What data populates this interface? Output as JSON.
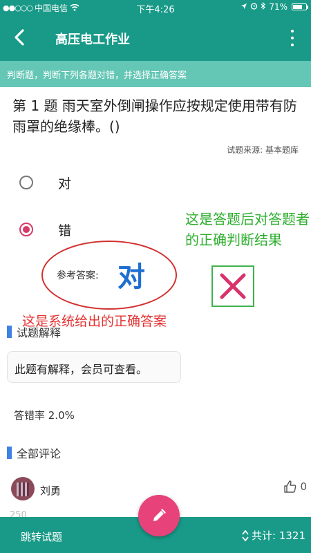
{
  "status_bar": {
    "carrier": "中国电信",
    "time": "下午4:26",
    "battery": "71%",
    "battery_level": 0.71
  },
  "header": {
    "title": "高压电工作业",
    "back_icon": "chevron-left-icon",
    "menu_icon": "more-vertical-icon"
  },
  "instruction": "判断题，判断下列各题对错，并选择正确答案",
  "question": {
    "text": "第 1 题 雨天室外倒闸操作应按规定使用带有防雨罩的绝缘棒。()",
    "source": "试题来源: 基本题库"
  },
  "options": [
    {
      "label": "对",
      "selected": false
    },
    {
      "label": "错",
      "selected": true
    }
  ],
  "answer": {
    "label": "参考答案:",
    "value": "对"
  },
  "annotations": {
    "green_note": "这是答题后对答题者的正确判断结果",
    "red_note": "这是系统给出的正确答案"
  },
  "explanation": {
    "heading": "试题解释",
    "text": "此题有解释，会员可查看。"
  },
  "error_rate": "答错率 2.0%",
  "comments": {
    "heading": "全部评论",
    "items": [
      {
        "user": "刘勇",
        "likes": "0",
        "snippet": "250"
      }
    ]
  },
  "bottom_bar": {
    "jump_label": "跳转试题",
    "total_label": "共计: 1321"
  },
  "colors": {
    "primary": "#199a88",
    "banner": "#64c6b5",
    "accent": "#e8427b",
    "radio_selected": "#d63a68"
  }
}
